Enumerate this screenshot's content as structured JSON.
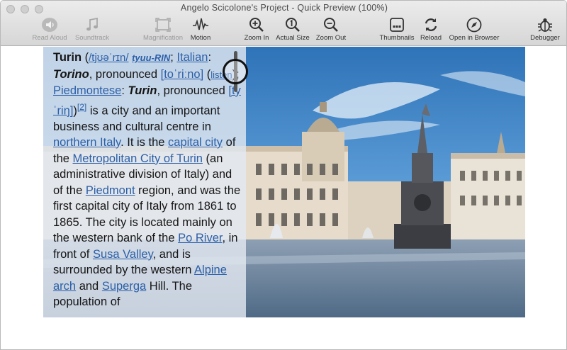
{
  "window": {
    "title": "Angelo Scicolone's Project - Quick Preview (100%)"
  },
  "toolbar": {
    "read_aloud": "Read Aloud",
    "soundtrack": "Soundtrack",
    "magnification": "Magnification",
    "motion": "Motion",
    "zoom_in": "Zoom In",
    "actual_size": "Actual Size",
    "zoom_out": "Zoom Out",
    "thumbnails": "Thumbnails",
    "reload": "Reload",
    "open_in_browser": "Open in Browser",
    "debugger": "Debugger"
  },
  "article": {
    "t1": "Turin",
    "t2": " (",
    "l1": "/tjʊəˈrɪn/",
    "t3": " ",
    "l2": "tyuu-RIN",
    "t4": "; ",
    "l3": "Italian",
    "t5": ": ",
    "t6": "Torino",
    "t7": ", pronounced ",
    "l4": "[toˈriːno]",
    "t8": " (",
    "l5": "listen",
    "t9": "); ",
    "l6": "Piedmontese",
    "t10": ": ",
    "t11": "Turin",
    "t12": ", pronounced ",
    "l7": "[tyˈriŋ]",
    "t13": ")",
    "l8": "[2]",
    "t14": " is a city and an important business and cultural centre in ",
    "l9": "northern Italy",
    "t15": ". It is the ",
    "l10": "capital city",
    "t16": " of the ",
    "l11": "Metropolitan City of Turin",
    "t17": " (an administrative division of Italy) and of the ",
    "l12": "Piedmont",
    "t18": " region, and was the first capital city of Italy from 1861 to 1865. The city is located mainly on the western bank of the ",
    "l13": "Po River",
    "t19": ", in front of ",
    "l14": "Susa Valley",
    "t20": ", and is surrounded by the western ",
    "l15": "Alpine arch",
    "t21": " and ",
    "l16": "Superga",
    "t22": " Hill. The population of"
  },
  "colors": {
    "link": "#2b5fa8",
    "sky": "#3f86c9",
    "panel": "#e2e8f0"
  }
}
